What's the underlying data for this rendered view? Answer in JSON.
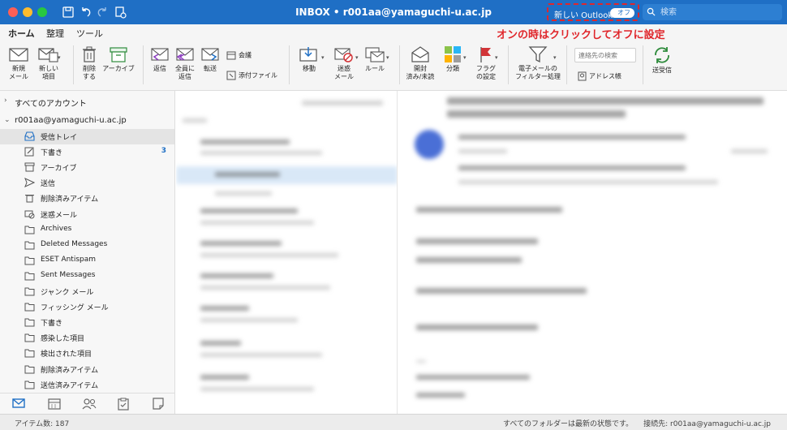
{
  "window": {
    "title": "INBOX • r001aa@yamaguchi-u.ac.jp",
    "new_outlook_label": "新しい Outlook",
    "toggle_state": "オフ",
    "search_placeholder": "検索"
  },
  "annotation": "オンの時はクリックしてオフに設定",
  "ribbon_tabs": [
    "ホーム",
    "整理",
    "ツール"
  ],
  "ribbon": {
    "new_mail": "新規\nメール",
    "new_item": "新しい\n項目",
    "delete": "削除\nする",
    "archive": "アーカイブ",
    "reply": "返信",
    "reply_all": "全員に\n返信",
    "forward": "転送",
    "meeting": "会議",
    "attachment": "添付ファイル",
    "move": "移動",
    "junk": "迷惑\nメール",
    "rules": "ルール",
    "read_unread": "開封\n済み/未読",
    "categorize": "分類",
    "flag": "フラグ\nの設定",
    "email_filter": "電子メールの\nフィルター処理",
    "contact_search_placeholder": "連絡先の検索",
    "address_book": "アドレス帳",
    "send_receive": "送受信"
  },
  "sidebar": {
    "all_accounts": "すべてのアカウント",
    "account": "r001aa@yamaguchi-u.ac.jp",
    "folders": [
      {
        "name": "受信トレイ",
        "icon": "inbox-icon",
        "count": ""
      },
      {
        "name": "下書き",
        "icon": "draft-icon",
        "count": "3"
      },
      {
        "name": "アーカイブ",
        "icon": "archive-icon",
        "count": ""
      },
      {
        "name": "送信",
        "icon": "sent-icon",
        "count": ""
      },
      {
        "name": "削除済みアイテム",
        "icon": "trash-icon",
        "count": ""
      },
      {
        "name": "迷惑メール",
        "icon": "junk-icon",
        "count": ""
      },
      {
        "name": "Archives",
        "icon": "folder-icon",
        "count": ""
      },
      {
        "name": "Deleted Messages",
        "icon": "folder-icon",
        "count": ""
      },
      {
        "name": "ESET Antispam",
        "icon": "folder-icon",
        "count": ""
      },
      {
        "name": "Sent Messages",
        "icon": "folder-icon",
        "count": ""
      },
      {
        "name": "ジャンク メール",
        "icon": "folder-icon",
        "count": ""
      },
      {
        "name": "フィッシング メール",
        "icon": "folder-icon",
        "count": ""
      },
      {
        "name": "下書き",
        "icon": "folder-icon",
        "count": ""
      },
      {
        "name": "感染した項目",
        "icon": "folder-icon",
        "count": ""
      },
      {
        "name": "検出された項目",
        "icon": "folder-icon",
        "count": ""
      },
      {
        "name": "削除済みアイテム",
        "icon": "folder-icon",
        "count": ""
      },
      {
        "name": "送信済みアイテム",
        "icon": "folder-icon",
        "count": ""
      }
    ]
  },
  "status": {
    "item_count": "アイテム数: 187",
    "sync_state": "すべてのフォルダーは最新の状態です。",
    "connection": "接続先: r001aa@yamaguchi-u.ac.jp"
  },
  "colors": {
    "accent": "#1f6fc5",
    "annotation": "#e0262b"
  }
}
